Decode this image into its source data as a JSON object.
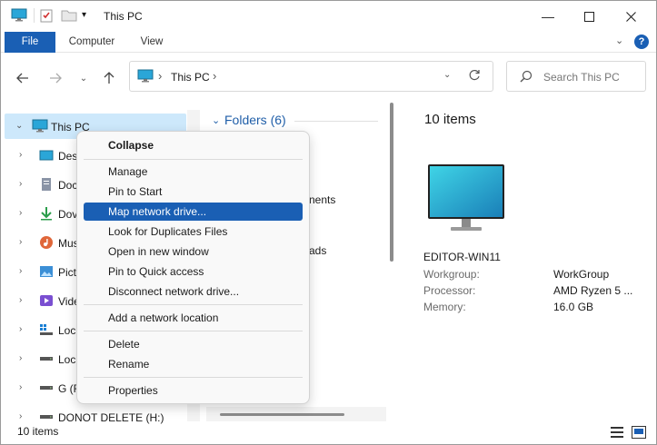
{
  "window": {
    "title": "This PC"
  },
  "ribbon": {
    "tabs": [
      "File",
      "Computer",
      "View"
    ]
  },
  "address": {
    "crumb": "This PC",
    "separator": "›"
  },
  "search": {
    "placeholder": "Search This PC"
  },
  "nav_tree": {
    "items": [
      {
        "label": "This PC",
        "icon": "pc-icon",
        "selected": true,
        "expanded": true
      },
      {
        "label": "Des",
        "icon": "desktop-icon"
      },
      {
        "label": "Doc",
        "icon": "documents-icon"
      },
      {
        "label": "Dov",
        "icon": "downloads-icon"
      },
      {
        "label": "Mus",
        "icon": "music-icon"
      },
      {
        "label": "Pict",
        "icon": "pictures-icon"
      },
      {
        "label": "Vide",
        "icon": "videos-icon"
      },
      {
        "label": "Loc",
        "icon": "drive-windows-icon"
      },
      {
        "label": "Loc",
        "icon": "drive-icon"
      },
      {
        "label": "G (F",
        "icon": "drive-icon"
      },
      {
        "label": "DONOT DELETE (H:)",
        "icon": "drive-icon"
      }
    ]
  },
  "content": {
    "folders_header": "Folders (6)",
    "fragments": [
      "nents",
      "ads"
    ]
  },
  "details": {
    "count": "10 items",
    "computer_name": "EDITOR-WIN11",
    "rows": [
      {
        "key": "Workgroup:",
        "value": "WorkGroup"
      },
      {
        "key": "Processor:",
        "value": "AMD Ryzen 5 ..."
      },
      {
        "key": "Memory:",
        "value": "16.0 GB"
      }
    ]
  },
  "status": {
    "text": "10 items"
  },
  "context_menu": {
    "items": [
      {
        "label": "Collapse",
        "bold": true
      },
      {
        "separator": true
      },
      {
        "label": "Manage"
      },
      {
        "label": "Pin to Start"
      },
      {
        "label": "Map network drive...",
        "highlighted": true
      },
      {
        "label": "Look for Duplicates Files"
      },
      {
        "label": "Open in new window"
      },
      {
        "label": "Pin to Quick access"
      },
      {
        "label": "Disconnect network drive..."
      },
      {
        "separator": true
      },
      {
        "label": "Add a network location"
      },
      {
        "separator": true
      },
      {
        "label": "Delete"
      },
      {
        "label": "Rename"
      },
      {
        "separator": true
      },
      {
        "label": "Properties"
      }
    ]
  },
  "colors": {
    "accent": "#1a5fb4",
    "selection": "#cde8fb",
    "folder_header": "#1f5ea8"
  }
}
